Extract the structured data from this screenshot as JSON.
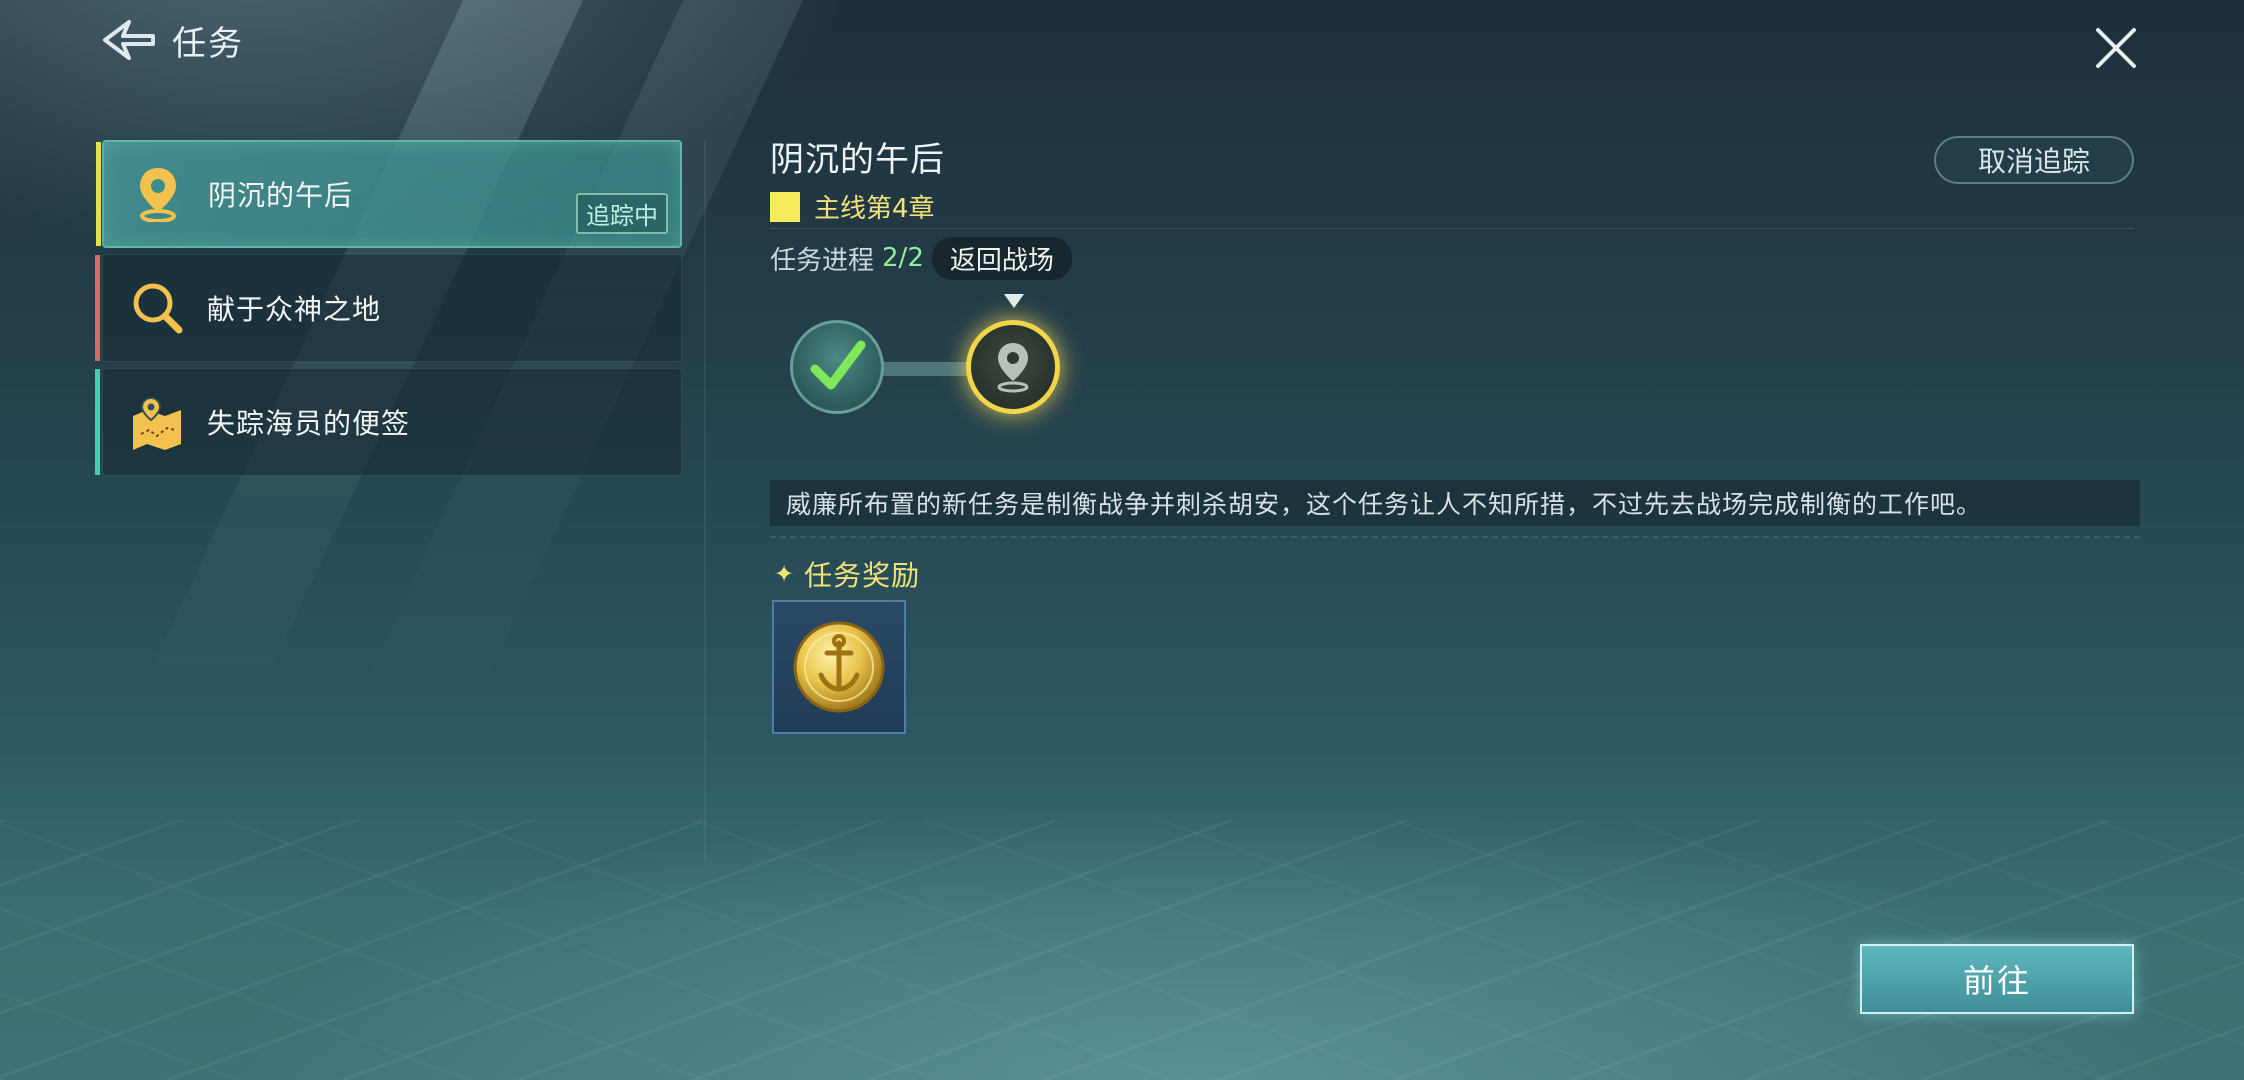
{
  "header": {
    "title": "任务",
    "back_icon": "back-arrow-icon",
    "close_icon": "close-icon"
  },
  "quest_list": [
    {
      "label": "阴沉的午后",
      "icon": "map-pin-icon",
      "stripe_color": "#e8e04a",
      "active": true,
      "tag": "追踪中"
    },
    {
      "label": "献于众神之地",
      "icon": "magnifier-icon",
      "stripe_color": "#d6696a",
      "active": false
    },
    {
      "label": "失踪海员的便签",
      "icon": "treasure-map-icon",
      "stripe_color": "#3fd1b3",
      "active": false
    }
  ],
  "detail": {
    "title": "阴沉的午后",
    "chapter": "主线第4章",
    "chapter_color": "#f4ea5a",
    "untrack_label": "取消追踪",
    "progress_label": "任务进程",
    "progress_value": "2/2",
    "return_label": "返回战场",
    "description": "威廉所布置的新任务是制衡战争并刺杀胡安，这个任务让人不知所措，不过先去战场完成制衡的工作吧。",
    "reward_title": "任务奖励",
    "reward_item_icon": "gold-anchor-coin-icon",
    "go_label": "前往"
  }
}
